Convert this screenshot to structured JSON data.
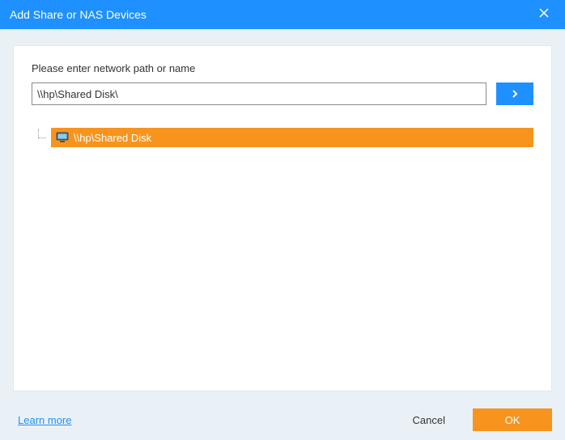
{
  "titlebar": {
    "title": "Add Share or NAS Devices"
  },
  "content": {
    "prompt": "Please enter network path or name",
    "path_value": "\\\\hp\\Shared Disk\\"
  },
  "tree": {
    "items": [
      {
        "label": "\\\\hp\\Shared Disk"
      }
    ]
  },
  "footer": {
    "learn_more": "Learn more",
    "cancel": "Cancel",
    "ok": "OK"
  }
}
